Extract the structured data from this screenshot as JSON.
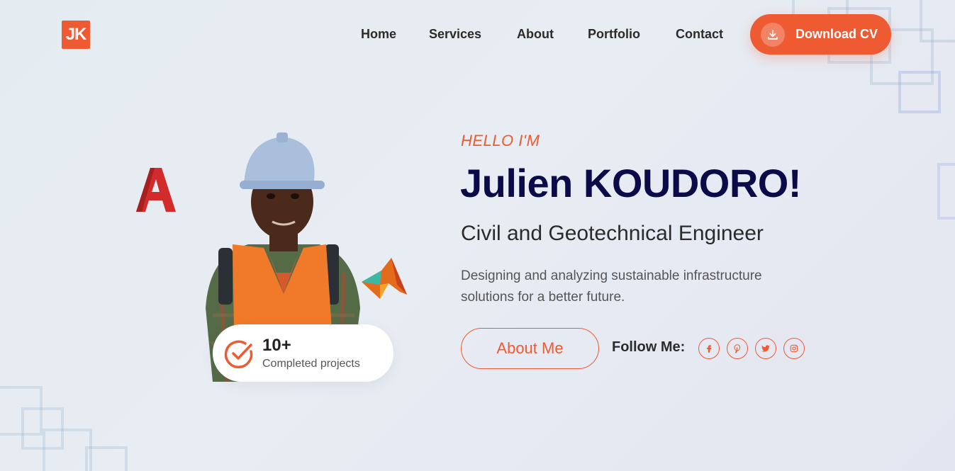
{
  "brand": {
    "logo_text": "JK",
    "accent": "#ee5a32",
    "heading_color": "#0b0b4a"
  },
  "nav": {
    "items": [
      "Home",
      "Services",
      "About",
      "Portfolio",
      "Contact"
    ],
    "cta_label": "Download CV",
    "cta_icon": "download-icon"
  },
  "hero": {
    "greeting": "HELLO I'M",
    "name": "Julien KOUDORO!",
    "role": "Civil and Geotechnical Engineer",
    "description": "Designing and analyzing sustainable infrastructure solutions for a better future.",
    "about_label": "About Me",
    "follow_label": "Follow Me:",
    "social_icons": [
      "facebook-icon",
      "pinterest-icon",
      "twitter-icon",
      "instagram-icon"
    ]
  },
  "badge": {
    "count": "10+",
    "label": "Completed projects",
    "icon": "check-circle-icon"
  },
  "floating_icons": [
    "autocad-logo",
    "matlab-logo"
  ]
}
